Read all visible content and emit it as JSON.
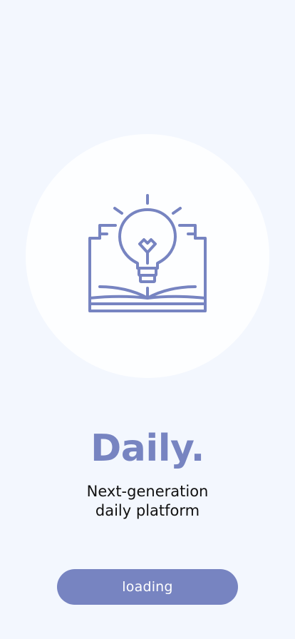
{
  "colors": {
    "background": "#f3f7fe",
    "circle": "#fdfeff",
    "accent": "#7784c1",
    "text": "#111111",
    "button_text": "#ffffff"
  },
  "hero": {
    "icon": "open-book-lightbulb-icon"
  },
  "brand": {
    "title": "Daily."
  },
  "tagline": {
    "line1": "Next-generation",
    "line2": "daily platform"
  },
  "button": {
    "label": "loading"
  }
}
